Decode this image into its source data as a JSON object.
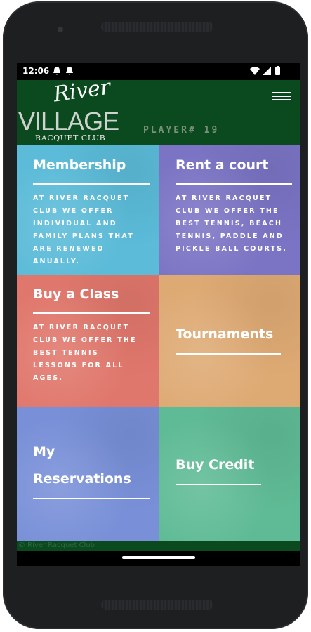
{
  "status": {
    "time": "12:06"
  },
  "header": {
    "logo_river": "River",
    "logo_village": "VILLAGE",
    "logo_sub": "RACQUET CLUB",
    "player": "PLAYER# 19"
  },
  "tiles": [
    {
      "title": "Membership",
      "desc": "AT RIVER RACQUET CLUB WE OFFER INDIVIDUAL AND FAMILY PLANS THAT ARE RENEWED ANUALLY.",
      "color": "#5bbbd8"
    },
    {
      "title": "Rent a court",
      "desc": "AT RIVER RACQUET CLUB WE OFFER THE BEST TENNIS, BEACH TENNIS, PADDLE AND PICKLE BALL COURTS.",
      "color": "#7b74c4"
    },
    {
      "title": "Buy a Class",
      "desc": "AT RIVER RACQUET CLUB WE OFFER THE BEST TENNIS LESSONS FOR ALL AGES.",
      "color": "#e0776c"
    },
    {
      "title": "Tournaments",
      "desc": "",
      "color": "#deaa74"
    },
    {
      "title_line1": "My",
      "title_line2": "Reservations",
      "color": "#7990d8"
    },
    {
      "title": "Buy Credit",
      "color": "#5fbb95"
    }
  ],
  "footer": {
    "text": "© River Racquet Club"
  }
}
